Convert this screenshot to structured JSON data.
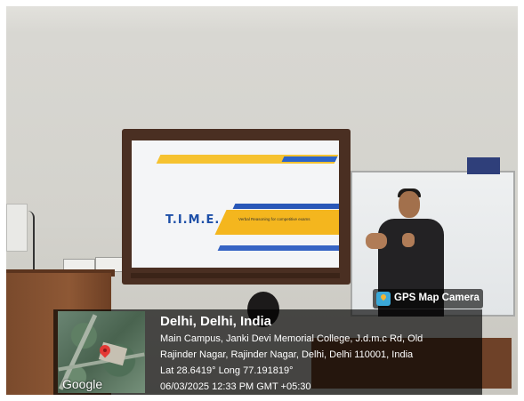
{
  "photo": {
    "description_colors": {
      "wall": "#d9d8d3",
      "frame": "#4a2f22",
      "accent_yellow": "#f6c230",
      "accent_blue": "#2b63c9"
    }
  },
  "slide": {
    "logo": "T.I.M.E.",
    "caption": "Verbal Reasoning for competitive exams"
  },
  "gps": {
    "app_name": "GPS Map Camera",
    "title": "Delhi, Delhi, India",
    "address_line1": "Main Campus, Janki Devi Memorial College, J.d.m.c Rd, Old",
    "address_line2": "Rajinder Nagar, Rajinder Nagar, Delhi, Delhi 110001, India",
    "coordinates": "Lat 28.6419° Long 77.191819°",
    "datetime": "06/03/2025 12:33 PM GMT +05:30",
    "map_brand": "Google"
  }
}
